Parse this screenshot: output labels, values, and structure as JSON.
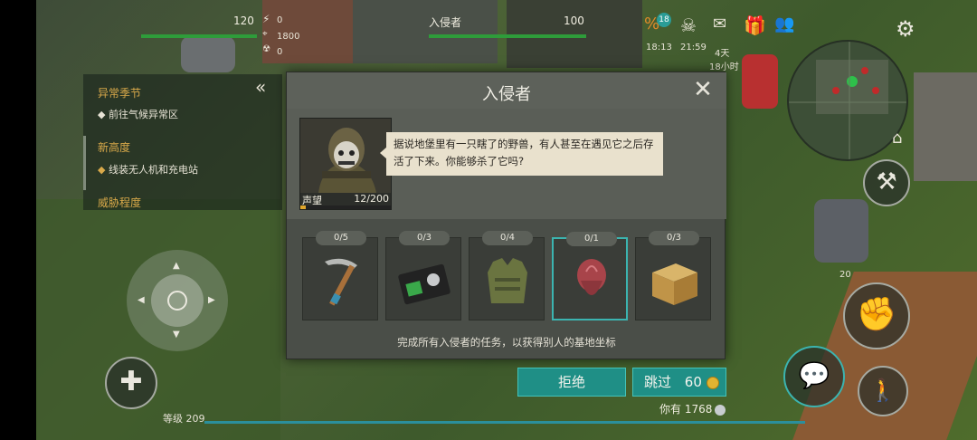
{
  "hud": {
    "health": "120",
    "enemy_name": "入侵者",
    "enemy_health": "100",
    "stat1": "0",
    "stat2": "1800",
    "stat3": "0",
    "badge_count": "18",
    "time1": "18:13",
    "time2": "21:59",
    "days": "4天",
    "hours": "18小时",
    "hud_small_20": "20"
  },
  "quests": {
    "h1": "异常季节",
    "i1": "前往气候异常区",
    "h2": "新高度",
    "i2": "线装无人机和充电站",
    "h3": "威胁程度"
  },
  "dialog": {
    "title": "入侵者",
    "speech": "据说地堡里有一只瞎了的野兽，有人甚至在遇见它之后存活了下来。你能够杀了它吗?",
    "reputation_label": "声望",
    "reputation_value": "12/200",
    "reputation_progress": 0.06,
    "items": [
      {
        "count": "0/5",
        "icon": "pickaxe-icon"
      },
      {
        "count": "0/3",
        "icon": "police-badge-icon"
      },
      {
        "count": "0/4",
        "icon": "armor-vest-icon"
      },
      {
        "count": "0/1",
        "icon": "beast-head-icon"
      },
      {
        "count": "0/3",
        "icon": "cardboard-box-icon"
      }
    ],
    "footer": "完成所有入侵者的任务，以获得别人的基地坐标"
  },
  "actions": {
    "refuse": "拒绝",
    "skip": "跳过",
    "skip_cost": "60",
    "have_label": "你有",
    "have_value": "1768"
  },
  "level": "等级 209",
  "colors": {
    "accent_teal": "#1f8f86",
    "health_green": "#2e9c3a",
    "quest_header": "#d9a94a"
  }
}
